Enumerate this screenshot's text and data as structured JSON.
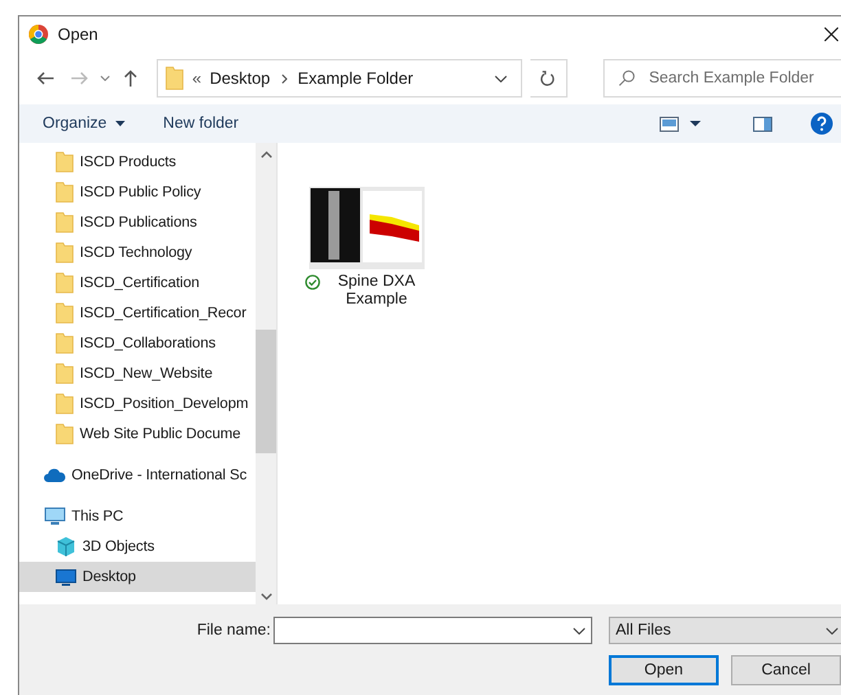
{
  "window": {
    "title": "Open"
  },
  "address": {
    "overflow": "«",
    "path": [
      "Desktop",
      "Example Folder"
    ]
  },
  "search": {
    "placeholder": "Search Example Folder"
  },
  "toolbar": {
    "organize": "Organize",
    "new_folder": "New folder"
  },
  "nav": {
    "items": [
      {
        "label": "ISCD Products",
        "kind": "folder",
        "selected": false
      },
      {
        "label": "ISCD Public Policy",
        "kind": "folder",
        "selected": false
      },
      {
        "label": "ISCD Publications",
        "kind": "folder",
        "selected": false
      },
      {
        "label": "ISCD Technology",
        "kind": "folder",
        "selected": false
      },
      {
        "label": "ISCD_Certification",
        "kind": "folder",
        "selected": false
      },
      {
        "label": "ISCD_Certification_Recor",
        "kind": "folder",
        "selected": false
      },
      {
        "label": "ISCD_Collaborations",
        "kind": "folder",
        "selected": false
      },
      {
        "label": "ISCD_New_Website",
        "kind": "folder",
        "selected": false
      },
      {
        "label": "ISCD_Position_Developm",
        "kind": "folder",
        "selected": false
      },
      {
        "label": "Web Site Public Docume",
        "kind": "folder",
        "selected": false
      },
      {
        "label": "OneDrive - International Sc",
        "kind": "cloud",
        "selected": false
      },
      {
        "label": "This PC",
        "kind": "pc",
        "selected": false,
        "children": [
          {
            "label": "3D Objects",
            "kind": "cube",
            "selected": false
          },
          {
            "label": "Desktop",
            "kind": "desktop",
            "selected": true
          }
        ]
      }
    ]
  },
  "files": [
    {
      "name": "Spine DXA Example",
      "synced": true
    }
  ],
  "file_name": {
    "label": "File name:"
  },
  "file_type": "All Files",
  "buttons": [
    {
      "label": "Open",
      "default": true
    },
    {
      "label": "Cancel",
      "default": false
    }
  ]
}
